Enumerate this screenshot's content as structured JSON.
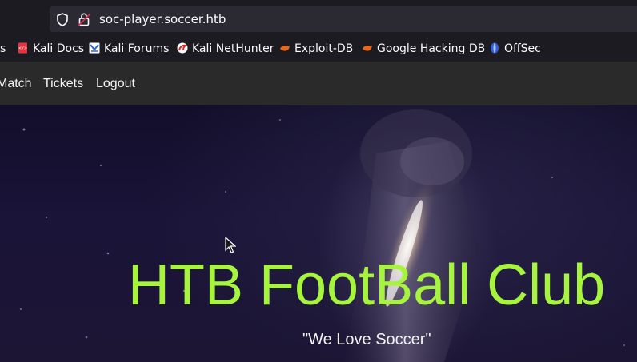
{
  "browser": {
    "url": "soc-player.soccer.htb",
    "bookmarks": [
      {
        "label": "s",
        "icon": "partial-icon"
      },
      {
        "label": "Kali Docs",
        "icon": "kali-docs-icon"
      },
      {
        "label": "Kali Forums",
        "icon": "kali-forums-icon"
      },
      {
        "label": "Kali NetHunter",
        "icon": "kali-nethunter-icon"
      },
      {
        "label": "Exploit-DB",
        "icon": "exploit-db-icon"
      },
      {
        "label": "Google Hacking DB",
        "icon": "ghdb-icon"
      },
      {
        "label": "OffSec",
        "icon": "offsec-icon"
      }
    ]
  },
  "navbar": {
    "links": [
      "Match",
      "Tickets",
      "Logout"
    ]
  },
  "hero": {
    "title": "HTB FootBall Club",
    "tagline": "\"We Love Soccer\""
  },
  "colors": {
    "accent": "#a7f43f",
    "navbar_bg": "#2a2a2a",
    "chrome_bg": "#1c1b22",
    "urlbar_bg": "#2b2a33"
  }
}
